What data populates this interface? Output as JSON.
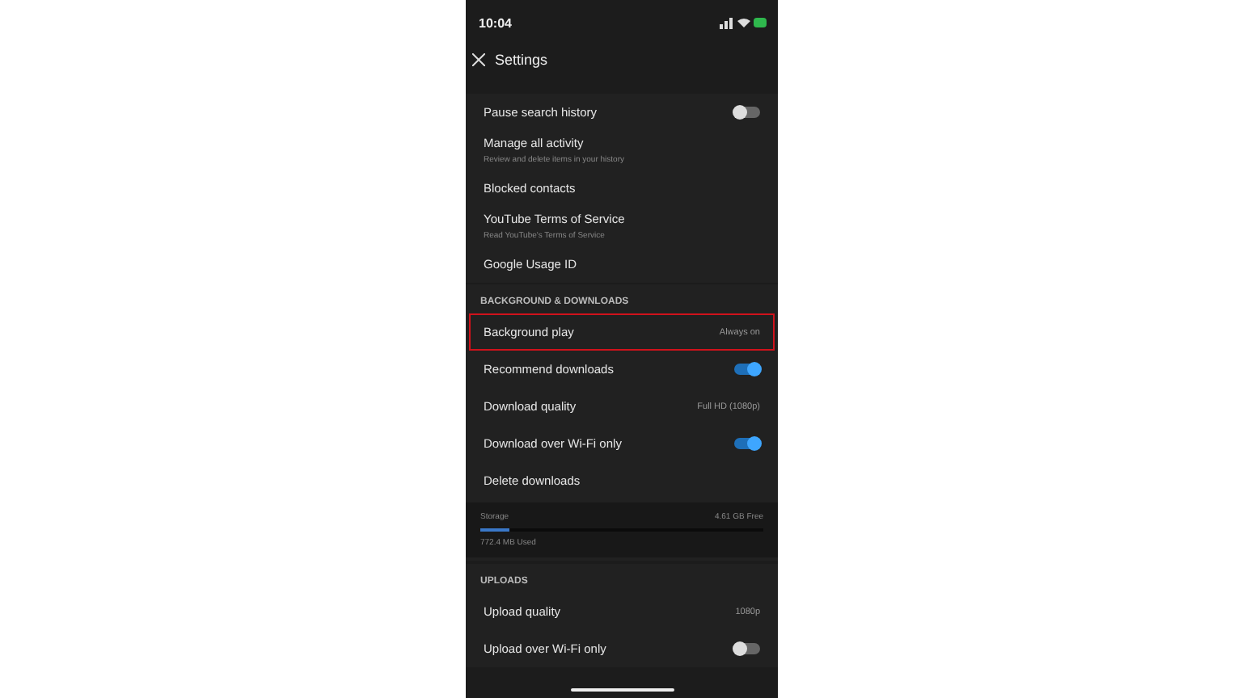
{
  "status_bar": {
    "time": "10:04"
  },
  "header": {
    "title": "Settings"
  },
  "sections": [
    {
      "items": [
        {
          "kind": "toggle",
          "label": "Pause search history",
          "on": false,
          "highlighted": false
        },
        {
          "kind": "link",
          "label": "Manage all activity",
          "subtitle": "Review and delete items in your history",
          "highlighted": false
        },
        {
          "kind": "link",
          "label": "Blocked contacts",
          "highlighted": false
        },
        {
          "kind": "link",
          "label": "YouTube Terms of Service",
          "subtitle": "Read YouTube's Terms of Service",
          "highlighted": false
        },
        {
          "kind": "link",
          "label": "Google Usage ID",
          "highlighted": false
        }
      ]
    },
    {
      "title": "BACKGROUND & DOWNLOADS",
      "items": [
        {
          "kind": "value",
          "label": "Background play",
          "value": "Always on",
          "highlighted": true
        },
        {
          "kind": "toggle",
          "label": "Recommend downloads",
          "on": true,
          "highlighted": false
        },
        {
          "kind": "value",
          "label": "Download quality",
          "value": "Full HD (1080p)",
          "highlighted": false
        },
        {
          "kind": "toggle",
          "label": "Download over Wi-Fi only",
          "on": true,
          "highlighted": false
        },
        {
          "kind": "link",
          "label": "Delete downloads",
          "highlighted": false
        },
        {
          "kind": "storage",
          "label": "Storage",
          "value": "4.61 GB Free",
          "used": "772.4 MB Used",
          "level": 0.1,
          "highlighted": false
        }
      ]
    },
    {
      "title": "UPLOADS",
      "items": [
        {
          "kind": "value",
          "label": "Upload quality",
          "value": "1080p",
          "highlighted": false
        },
        {
          "kind": "toggle",
          "label": "Upload over Wi-Fi only",
          "on": false,
          "highlighted": false
        }
      ]
    }
  ]
}
